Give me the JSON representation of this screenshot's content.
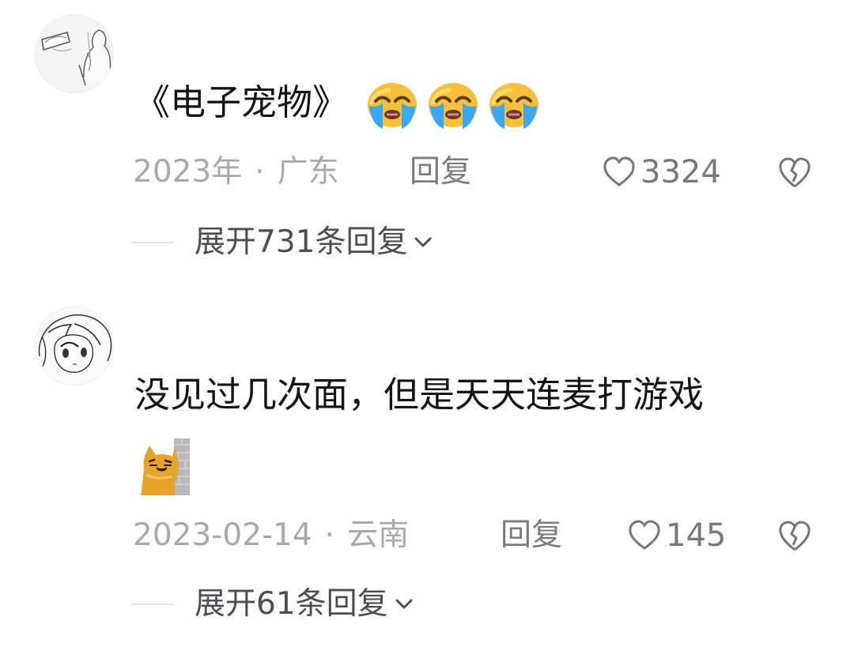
{
  "comments": [
    {
      "text": "《电子宠物》",
      "avatar_icon": "sketch-avatar-icon",
      "emojis": [
        "crying-face-icon",
        "crying-face-icon",
        "crying-face-icon"
      ],
      "date": "2023年",
      "location": "广东",
      "separator": "·",
      "reply_label": "回复",
      "like_count": "3324",
      "expand_label": "展开731条回复",
      "dislike_icon": "broken-heart-icon"
    },
    {
      "text": "没见过几次面，但是天天连麦打游戏",
      "avatar_icon": "anime-avatar-icon",
      "sticker": "peeking-cat-icon",
      "date": "2023-02-14",
      "location": "云南",
      "separator": "·",
      "reply_label": "回复",
      "like_count": "145",
      "expand_label": "展开61条回复",
      "dislike_icon": "broken-heart-icon"
    }
  ],
  "colors": {
    "background": "#ffffff",
    "primary_text": "#151515",
    "meta_text": "#a9a9ad",
    "secondary_text": "#4d4d52",
    "divider": "#e5e5e5",
    "emoji_yellow": "#f8c03a",
    "tear_blue": "#39a7f6",
    "cat_orange": "#e7a42a"
  }
}
